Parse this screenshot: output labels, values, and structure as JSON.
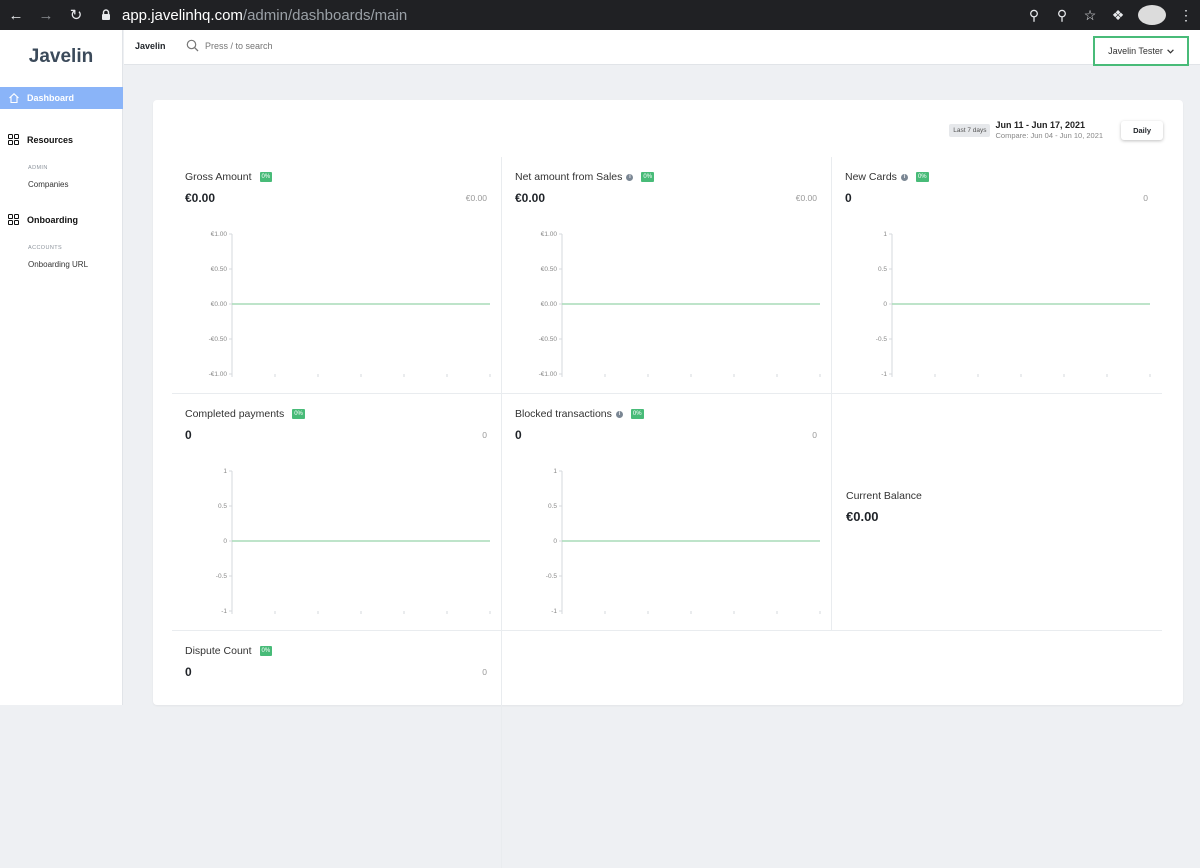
{
  "browser": {
    "url_host": "app.javelinhq.com",
    "url_path": "/admin/dashboards/main"
  },
  "sidebar": {
    "logo": "Javelin",
    "active_item": "Dashboard",
    "groups": [
      {
        "label": "Resources",
        "caption": "ADMIN",
        "link": "Companies"
      },
      {
        "label": "Onboarding",
        "caption": "ACCOUNTS",
        "link": "Onboarding URL"
      }
    ]
  },
  "topbar": {
    "brand": "Javelin",
    "search_placeholder": "Press / to search",
    "user": "Javelin Tester"
  },
  "dashboard": {
    "range_label": "Last 7 days",
    "date_range": "Jun 11 - Jun 17, 2021",
    "compare": "Compare: Jun 04 - Jun 10, 2021",
    "granularity": "Daily",
    "accent": "#48bb78",
    "metrics": [
      {
        "title": "Gross Amount",
        "info": false,
        "badge": "0%",
        "value": "€0.00",
        "compare": "€0.00",
        "ticks": [
          "€1.00",
          "€0.50",
          "€0.00",
          "-€0.50",
          "-€1.00"
        ]
      },
      {
        "title": "Net amount from Sales",
        "info": true,
        "badge": "0%",
        "value": "€0.00",
        "compare": "€0.00",
        "ticks": [
          "€1.00",
          "€0.50",
          "€0.00",
          "-€0.50",
          "-€1.00"
        ]
      },
      {
        "title": "New Cards",
        "info": true,
        "badge": "0%",
        "value": "0",
        "compare": "0",
        "ticks": [
          "1",
          "0.5",
          "0",
          "-0.5",
          "-1"
        ]
      },
      {
        "title": "Completed payments",
        "info": false,
        "badge": "0%",
        "value": "0",
        "compare": "0",
        "ticks": [
          "1",
          "0.5",
          "0",
          "-0.5",
          "-1"
        ]
      },
      {
        "title": "Blocked transactions",
        "info": true,
        "badge": "0%",
        "value": "0",
        "compare": "0",
        "ticks": [
          "1",
          "0.5",
          "0",
          "-0.5",
          "-1"
        ]
      },
      {
        "title": "Dispute Count",
        "info": false,
        "badge": "0%",
        "value": "0",
        "compare": "0",
        "ticks": []
      }
    ],
    "balance": {
      "title": "Current Balance",
      "value": "€0.00"
    }
  }
}
